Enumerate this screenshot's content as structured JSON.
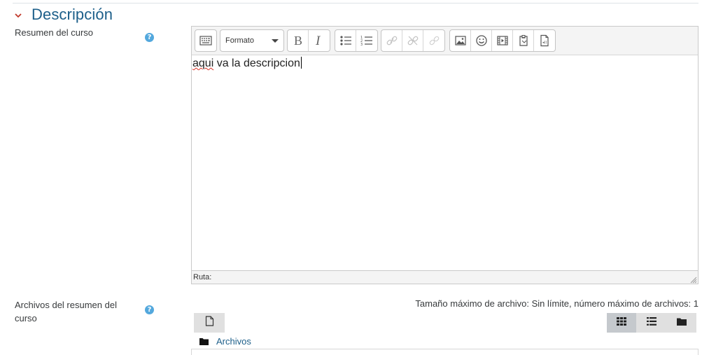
{
  "section": {
    "title": "Descripción"
  },
  "summary_field": {
    "label": "Resumen del curso",
    "help_glyph": "?",
    "toolbar": {
      "format_label": "Formato",
      "buttons": [
        "toolbar-toggle-icon",
        "bold-icon",
        "italic-icon",
        "unordered-list-icon",
        "ordered-list-icon",
        "link-icon",
        "unlink-icon",
        "manage-links-icon",
        "image-icon",
        "emoji-icon",
        "media-icon",
        "manage-files-icon",
        "media-file-icon"
      ]
    },
    "content": {
      "misspelled_word": "aqui",
      "rest": " va la descripcion"
    },
    "path_label": "Ruta:"
  },
  "files_field": {
    "label": "Archivos del resumen del curso",
    "help_glyph": "?",
    "max_info": "Tamaño máximo de archivo: Sin límite, número máximo de archivos: 1",
    "folder_label": "Archivos",
    "view_buttons": [
      "grid-view-icon",
      "list-view-icon",
      "folder-view-icon"
    ]
  },
  "colors": {
    "title": "#1d5f8a",
    "chevron": "#c0392b",
    "help": "#53a8dd",
    "link": "#1d5f8a"
  }
}
